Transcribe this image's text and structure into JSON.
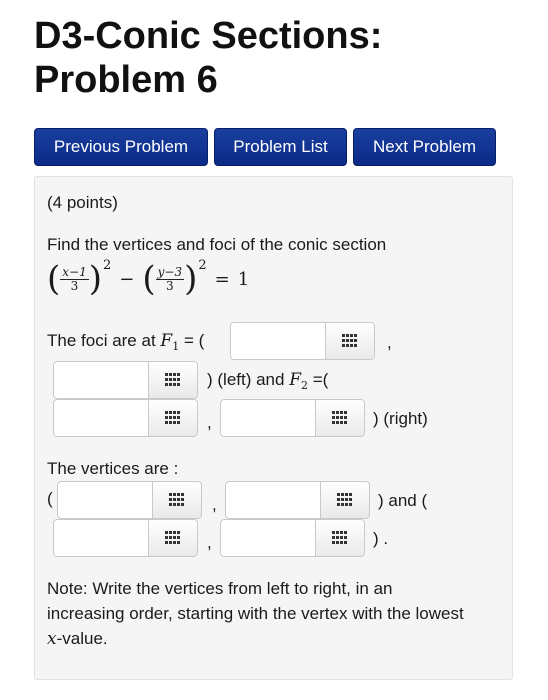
{
  "title": {
    "line1": "D3-Conic Sections:",
    "line2": "Problem 6"
  },
  "nav": {
    "previous_label": "Previous Problem",
    "list_label": "Problem List",
    "next_label": "Next Problem",
    "button_color": "#0b2a86"
  },
  "problem": {
    "points": "(4 points)",
    "intro": "Find the vertices and foci of the conic section",
    "equation": {
      "term1_num": "x−1",
      "term1_den": "3",
      "term2_num": "y−3",
      "term2_den": "3",
      "exponent": "2",
      "minus": "−",
      "equals": "=",
      "rhs": "1"
    },
    "foci": {
      "label": "The foci are at",
      "f1": "F",
      "f1_sub": "1",
      "f2": "F",
      "f2_sub": "2",
      "eq_open": "= (",
      "comma": ",",
      "left_and": ") (left) and",
      "eq_open2": "=(",
      "right_close": ") (right)"
    },
    "vertices": {
      "label": "The vertices are :",
      "open": "(",
      "comma": ",",
      "and_open": ") and (",
      "close": ") ."
    },
    "note": {
      "line1": "Note: Write the vertices from left to right, in an",
      "line2": "increasing order, starting with the vertex with the lowest",
      "var": "x",
      "line3_rest": "-value."
    },
    "input_icon": "keypad-icon"
  }
}
